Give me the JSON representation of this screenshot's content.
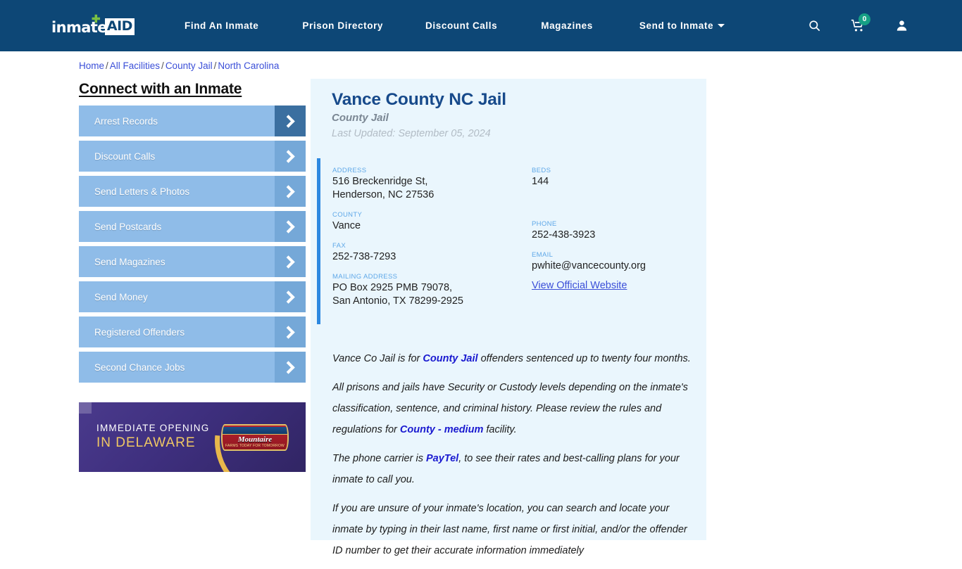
{
  "navbar": {
    "logo": {
      "part1": "inmate",
      "part2": "AID",
      "cross_icon": "green-cross-icon"
    },
    "links": [
      {
        "label": "Find An Inmate",
        "icon": null
      },
      {
        "label": "Prison Directory",
        "icon": null
      },
      {
        "label": "Discount Calls",
        "icon": null
      },
      {
        "label": "Magazines",
        "icon": null
      },
      {
        "label": "Send to Inmate",
        "icon": "chevron-down-icon"
      }
    ],
    "icons": {
      "search": "search-icon",
      "cart": "cart-icon",
      "cart_badge": "0",
      "account": "user-account-icon"
    },
    "background_color": "#0d4776"
  },
  "breadcrumb": {
    "items": [
      "Home",
      "All Facilities",
      "County Jail",
      "North Carolina"
    ],
    "separator": "/"
  },
  "sidebar": {
    "title": "Connect with an Inmate",
    "items": [
      {
        "label": "Arrest Records",
        "active": true
      },
      {
        "label": "Discount Calls",
        "active": false
      },
      {
        "label": "Send Letters & Photos",
        "active": false
      },
      {
        "label": "Send Postcards",
        "active": false
      },
      {
        "label": "Send Magazines",
        "active": false
      },
      {
        "label": "Send Money",
        "active": false
      },
      {
        "label": "Registered Offenders",
        "active": false
      },
      {
        "label": "Second Chance Jobs",
        "active": false
      }
    ],
    "button_color": "#8fbce8",
    "arrow_color": "#75a8d8",
    "active_arrow_color": "#3b6fa0"
  },
  "ad": {
    "line1": "IMMEDIATE OPENING",
    "line2": "IN DELAWARE",
    "brand": "Mountaire",
    "brand_sub": "FARMS TODAY FOR TOMORROW",
    "background_color": "#3e2f7e",
    "accent_color": "#e8b84b"
  },
  "facility": {
    "title": "Vance County NC Jail",
    "subtitle": "County Jail",
    "last_updated": "Last Updated: September 05, 2024",
    "accent_color": "#2d88e0",
    "panel_color": "#eaf6fd",
    "details_left": [
      {
        "label": "ADDRESS",
        "value": "516 Breckenridge St,\nHenderson, NC 27536"
      },
      {
        "label": "COUNTY",
        "value": "Vance"
      },
      {
        "label": "FAX",
        "value": "252-738-7293"
      },
      {
        "label": "MAILING ADDRESS",
        "value": "PO Box 2925 PMB 79078,\nSan Antonio, TX 78299-2925"
      }
    ],
    "details_right": [
      {
        "label": "BEDS",
        "value": "144"
      },
      {
        "label": "PHONE",
        "value": "252-438-3923"
      },
      {
        "label": "EMAIL",
        "value": "pwhite@vancecounty.org"
      }
    ],
    "official_website_label": "View Official Website"
  },
  "body_paragraphs": {
    "p1_a": "Vance Co Jail is for ",
    "p1_b": "County Jail",
    "p1_c": " offenders sentenced up to twenty four months.",
    "p2_a": "All prisons and jails have Security or Custody levels depending on the inmate's classification, sentence, and criminal history. Please review the rules and regulations for ",
    "p2_b": "County - medium",
    "p2_c": " facility.",
    "p3_a": "The phone carrier is ",
    "p3_b": "PayTel",
    "p3_c": ", to see their rates and best-calling plans for your inmate to call you.",
    "p4": "If you are unsure of your inmate's location, you can search and locate your inmate by typing in their last name, first name or first initial, and/or the offender ID number to get their accurate information immediately"
  }
}
